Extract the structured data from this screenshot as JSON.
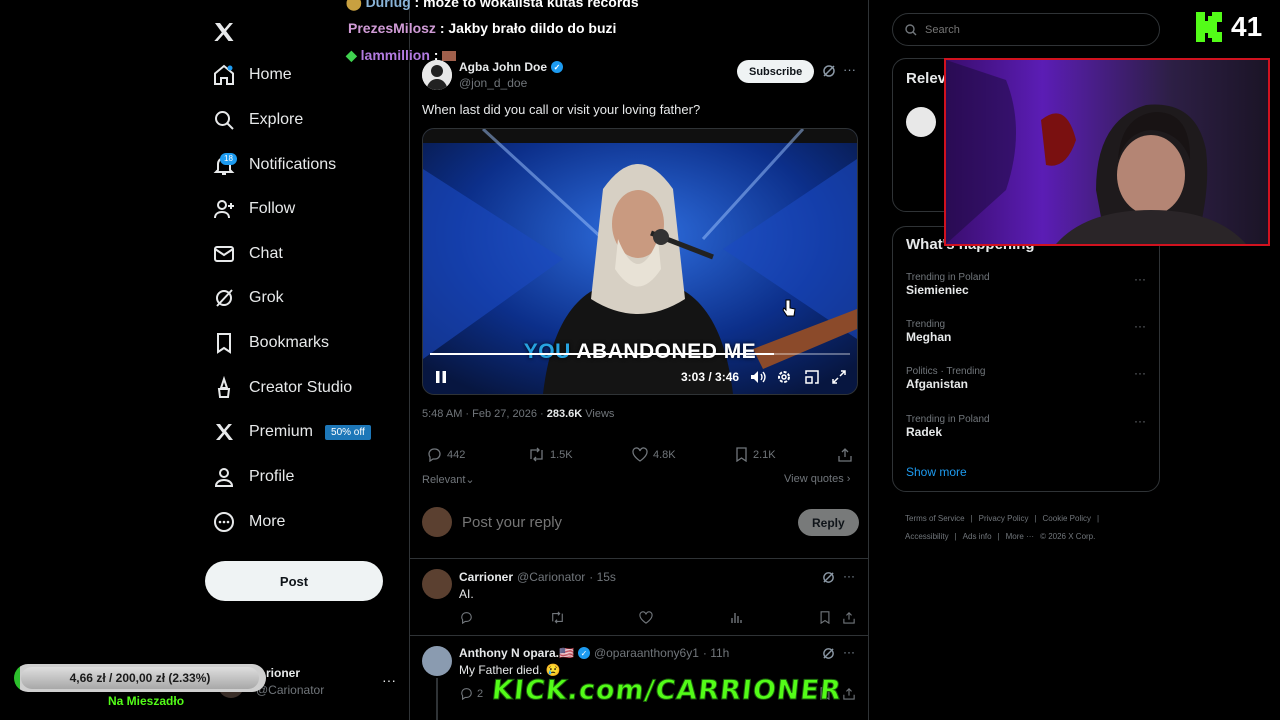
{
  "chat": [
    {
      "user": "Durlug",
      "message": "może to wokalista kutas records"
    },
    {
      "user": "PrezesMilosz",
      "message": "Jakby brało dildo do buzi"
    },
    {
      "user": "lammillion",
      "message": ""
    }
  ],
  "nav": {
    "items": [
      {
        "label": "Home",
        "icon": "home-icon"
      },
      {
        "label": "Explore",
        "icon": "search-icon"
      },
      {
        "label": "Notifications",
        "icon": "bell-icon"
      },
      {
        "label": "Follow",
        "icon": "add-user-icon"
      },
      {
        "label": "Chat",
        "icon": "mail-icon"
      },
      {
        "label": "Grok",
        "icon": "grok-icon"
      },
      {
        "label": "Bookmarks",
        "icon": "bookmark-icon"
      },
      {
        "label": "Creator Studio",
        "icon": "creator-studio-icon"
      },
      {
        "label": "Premium",
        "icon": "x-icon"
      },
      {
        "label": "Profile",
        "icon": "person-icon"
      },
      {
        "label": "More",
        "icon": "more-circle-icon"
      }
    ],
    "notification_count": "18",
    "premium_badge": "50% off",
    "post_label": "Post"
  },
  "account": {
    "name": "rioner",
    "handle": "@Carionator"
  },
  "donation": {
    "text": "4,66 zł / 200,00 zł (2.33%)",
    "progress": 0.0233,
    "label": "Na Mieszadło"
  },
  "tweet": {
    "author": "Agba John Doe",
    "handle": "@jon_d_doe",
    "subscribe_label": "Subscribe",
    "text": "When last did you call or visit your loving father?",
    "video": {
      "caption_highlight": "YOU",
      "caption_rest": "ABANDONED ME",
      "time": "3:03 / 3:46",
      "progress": 0.82
    },
    "time": "5:48 AM · Feb 27, 2026 · ",
    "views": "283.6K",
    "views_label": " Views",
    "replies": "442",
    "reposts": "1.5K",
    "likes": "4.8K",
    "bookmarks": "2.1K",
    "sort_label": "Relevant",
    "view_quotes": "View quotes"
  },
  "reply": {
    "placeholder": "Post your reply",
    "button": "Reply"
  },
  "comments": [
    {
      "name": "Carrioner",
      "handle": "@Carionator",
      "time": "· 15s",
      "text": "AI.",
      "replies": ""
    },
    {
      "name": "Anthony N opara.🇺🇸",
      "handle": "@oparaanthony6y1",
      "time": "· 11h",
      "text": "My Father died. 😢",
      "replies": "2"
    }
  ],
  "right": {
    "search_placeholder": "Search",
    "relevant_title": "Relev",
    "happening_title": "What's happening",
    "trends": [
      {
        "category": "Trending in Poland",
        "name": "Siemieniec"
      },
      {
        "category": "Trending",
        "name": "Meghan"
      },
      {
        "category": "Politics · Trending",
        "name": "Afganistan"
      },
      {
        "category": "Trending in Poland",
        "name": "Radek"
      }
    ],
    "show_more": "Show more",
    "footer": [
      "Terms of Service",
      "|",
      "Privacy Policy",
      "|",
      "Cookie Policy",
      "|",
      "Accessibility",
      "|",
      "Ads info",
      "|",
      "More ···",
      "© 2026 X Corp."
    ]
  },
  "stream": {
    "viewer_count": "41",
    "banner": "KICK.com/CARRIONER"
  },
  "colors": {
    "accent": "#1d9bf0",
    "kick_green": "#53fc18",
    "webcam_border": "#d1121f"
  }
}
